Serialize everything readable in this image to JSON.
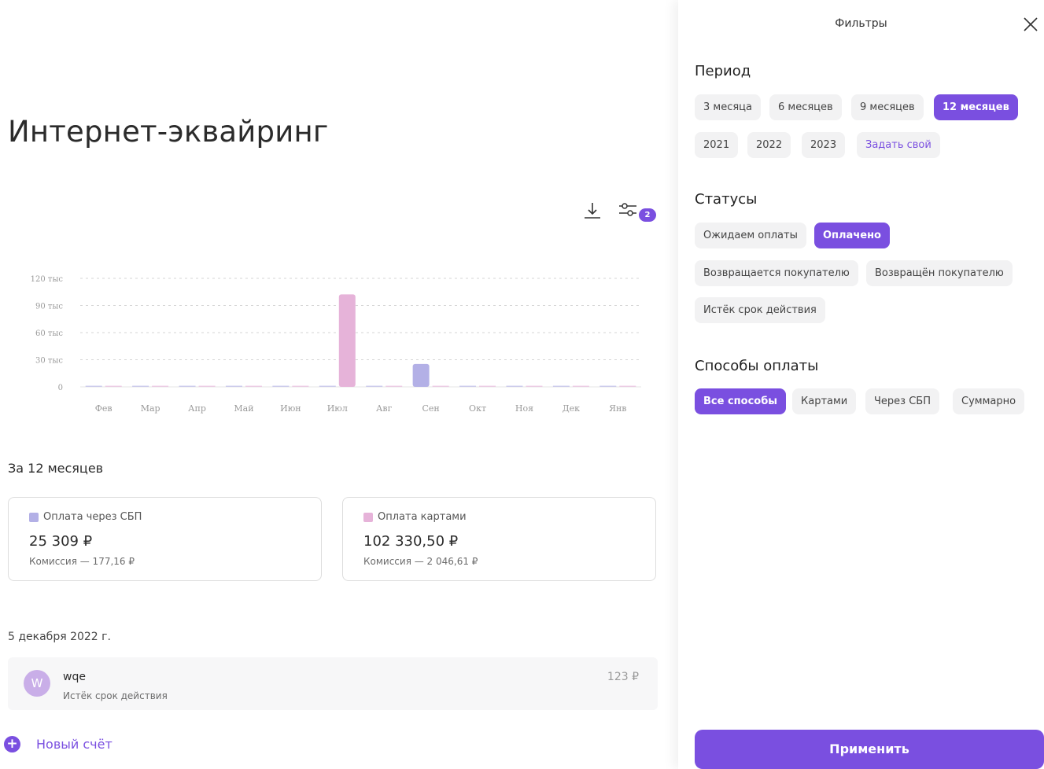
{
  "main": {
    "title": "Интернет-эквайринг",
    "filter_badge": "2",
    "period_label": "За 12 месяцев",
    "cards": {
      "sbp": {
        "label": "Оплата через СБП",
        "amount": "25 309 ₽",
        "commission": "Комиссия — 177,16 ₽",
        "color": "#b3b0e6"
      },
      "cards": {
        "label": "Оплата картами",
        "amount": "102 330,50 ₽",
        "commission": "Комиссия — 2 046,61 ₽",
        "color": "#e6b3d9"
      }
    },
    "date_group": "5 декабря 2022 г.",
    "invoice": {
      "avatar": "W",
      "name": "wqe",
      "status": "Истёк срок действия",
      "amount": "123 ₽"
    },
    "new_invoice_label": "Новый счёт"
  },
  "chart_data": {
    "type": "bar",
    "categories": [
      "Фев",
      "Мар",
      "Апр",
      "Май",
      "Июн",
      "Июл",
      "Авг",
      "Сен",
      "Окт",
      "Ноя",
      "Дек",
      "Янв"
    ],
    "series": [
      {
        "name": "Оплата через СБП",
        "color": "#b3b0e6",
        "values": [
          0,
          0,
          0,
          0,
          0,
          0,
          0,
          25309,
          0,
          0,
          0,
          0
        ]
      },
      {
        "name": "Оплата картами",
        "color": "#e6b3d9",
        "values": [
          0,
          0,
          0,
          0,
          0,
          102330.5,
          0,
          0,
          0,
          0,
          0,
          0
        ]
      }
    ],
    "y_ticks": [
      {
        "value": 0,
        "label": "0"
      },
      {
        "value": 30000,
        "label": "30 тыс"
      },
      {
        "value": 60000,
        "label": "60 тыс"
      },
      {
        "value": 90000,
        "label": "90 тыс"
      },
      {
        "value": 120000,
        "label": "120 тыс"
      }
    ],
    "ylim": [
      0,
      120000
    ],
    "grid": true
  },
  "filters": {
    "title": "Фильтры",
    "period": {
      "title": "Период",
      "options": [
        "3 месяца",
        "6 месяцев",
        "9 месяцев",
        "12 месяцев",
        "2021",
        "2022",
        "2023",
        "Задать свой"
      ],
      "selected": "12 месяцев"
    },
    "statuses": {
      "title": "Статусы",
      "options": [
        "Ожидаем оплаты",
        "Оплачено",
        "Возвращается покупателю",
        "Возвращён покупателю",
        "Истёк срок действия"
      ],
      "selected": "Оплачено"
    },
    "payment_methods": {
      "title": "Способы оплаты",
      "options": [
        "Все способы",
        "Картами",
        "Через СБП",
        "Суммарно"
      ],
      "selected": "Все способы"
    },
    "apply_label": "Применить"
  },
  "colors": {
    "accent": "#7a4fe0"
  }
}
